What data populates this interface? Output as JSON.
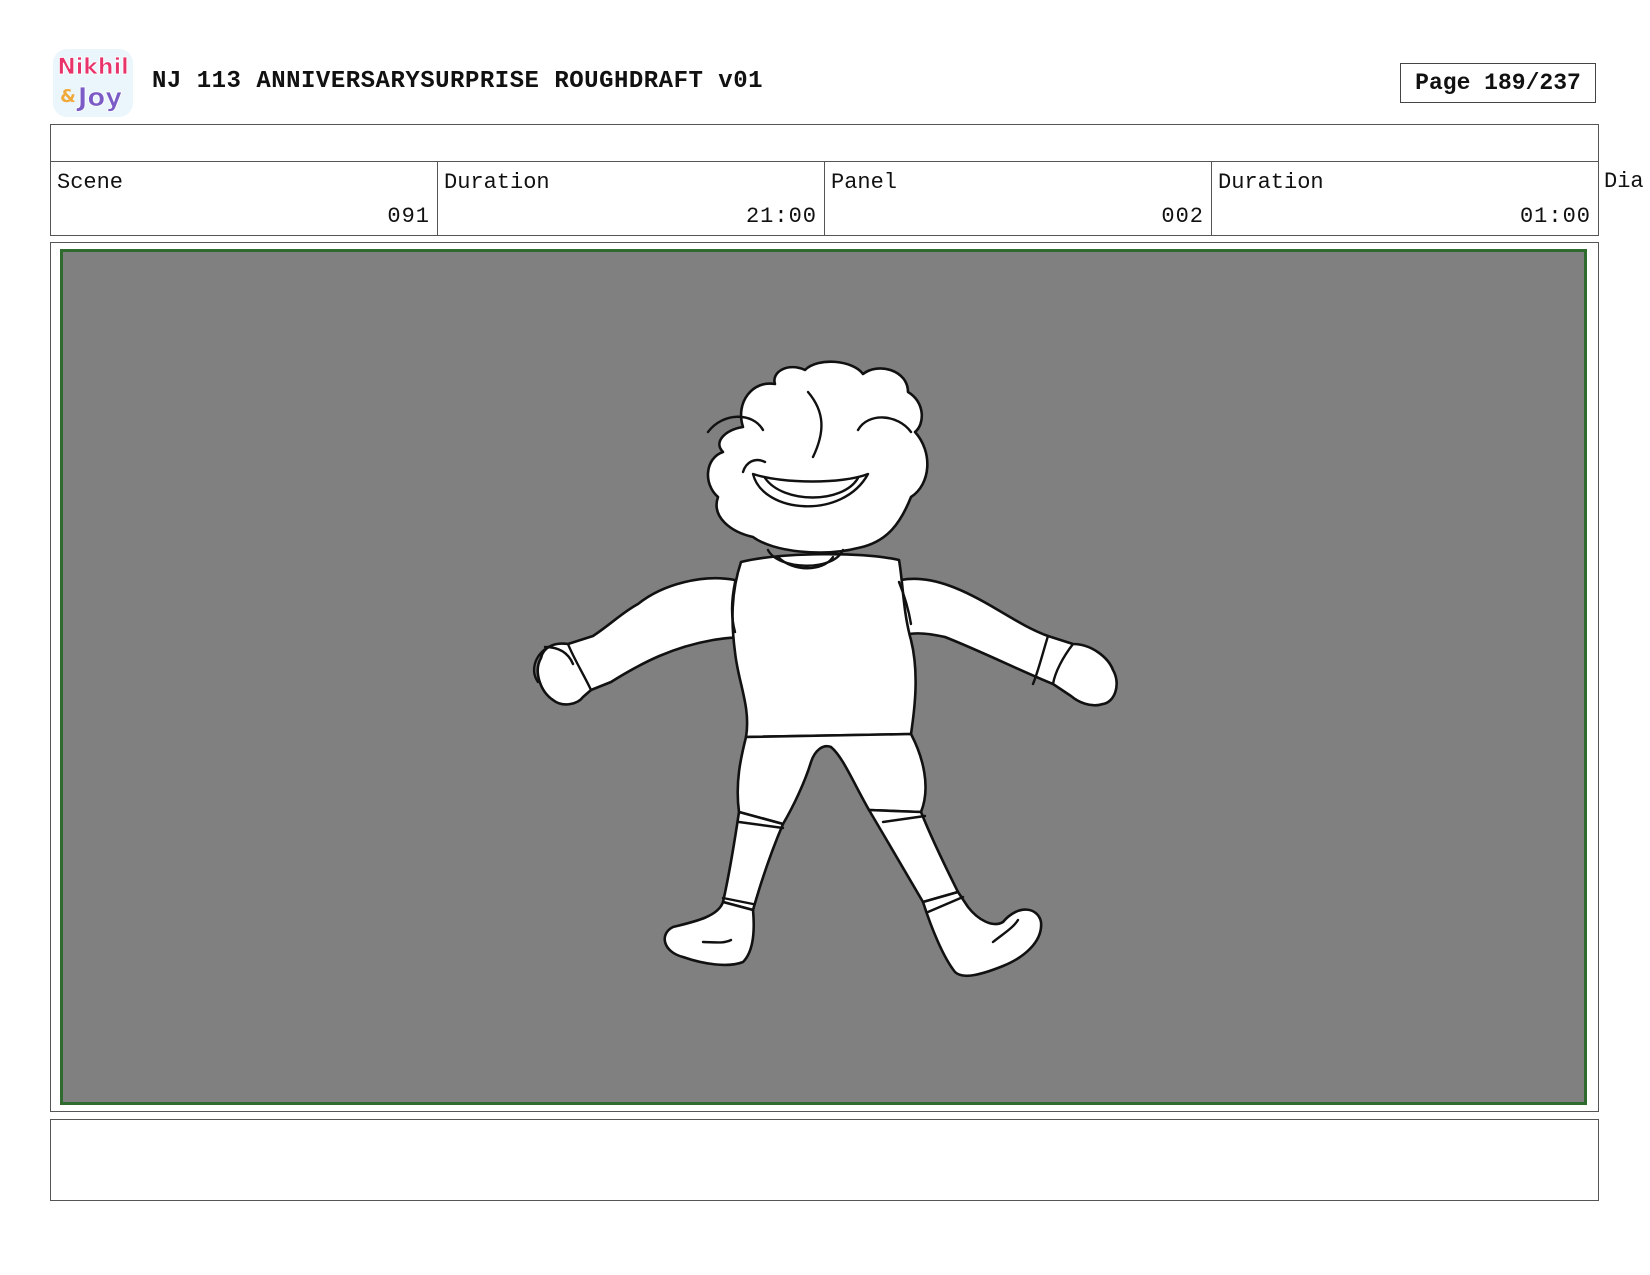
{
  "header": {
    "logo_text_top": "Nikhil",
    "logo_text_amp": "&",
    "logo_text_bottom": "Joy",
    "title": "NJ 113 ANNIVERSARYSURPRISE ROUGHDRAFT v01",
    "page": "Page 189/237"
  },
  "meta": {
    "scene_label": "Scene",
    "scene_value": "091",
    "scene_duration_label": "Duration",
    "scene_duration_value": "21:00",
    "panel_label": "Panel",
    "panel_value": "002",
    "panel_duration_label": "Duration",
    "panel_duration_value": "01:00",
    "dialogue_label": "Dia"
  },
  "colors": {
    "panel_background": "#808080",
    "panel_border": "#2f6b2f",
    "logo_pink": "#e8336b",
    "logo_purple": "#7b5cc7"
  }
}
